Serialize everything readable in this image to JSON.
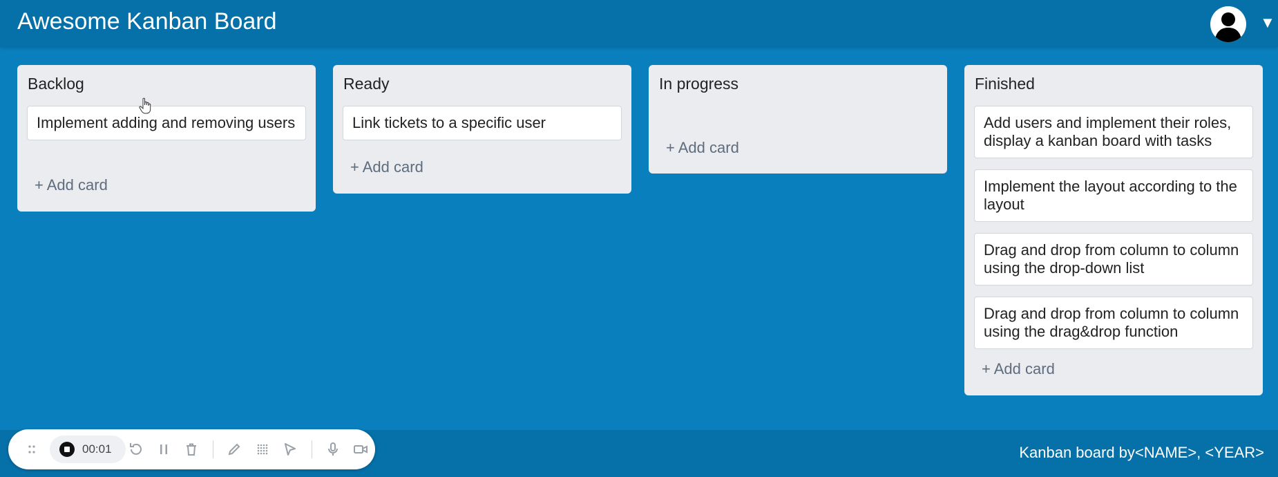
{
  "header": {
    "title": "Awesome Kanban Board",
    "menu_caret": "▼"
  },
  "columns": [
    {
      "title": "Backlog",
      "cards": [
        "Implement adding and removing users"
      ],
      "add_label": "+ Add card"
    },
    {
      "title": "Ready",
      "cards": [
        "Link tickets to a specific user"
      ],
      "add_label": "+ Add card"
    },
    {
      "title": "In progress",
      "cards": [],
      "add_label": "+ Add card"
    },
    {
      "title": "Finished",
      "cards": [
        "Add users and implement their roles, display a kanban board with tasks",
        "Implement the layout according to the layout",
        "Drag and drop from column to column using the drop-down list",
        "Drag and drop from column to column using the drag&drop function"
      ],
      "add_label": "+ Add card"
    }
  ],
  "footer": {
    "credit": "Kanban board by<NAME>, <YEAR>"
  },
  "recorder": {
    "time": "00:01",
    "icons": [
      "drag-handle-icon",
      "stop-icon",
      "restart-icon",
      "pause-icon",
      "trash-icon",
      "pen-icon",
      "grid-icon",
      "pointer-icon",
      "microphone-icon",
      "camera-icon"
    ]
  },
  "colors": {
    "background": "#0a7fbe",
    "header": "#0670a8",
    "column": "#eaecef",
    "card": "#ffffff",
    "add_card_text": "#5e6c7e"
  }
}
